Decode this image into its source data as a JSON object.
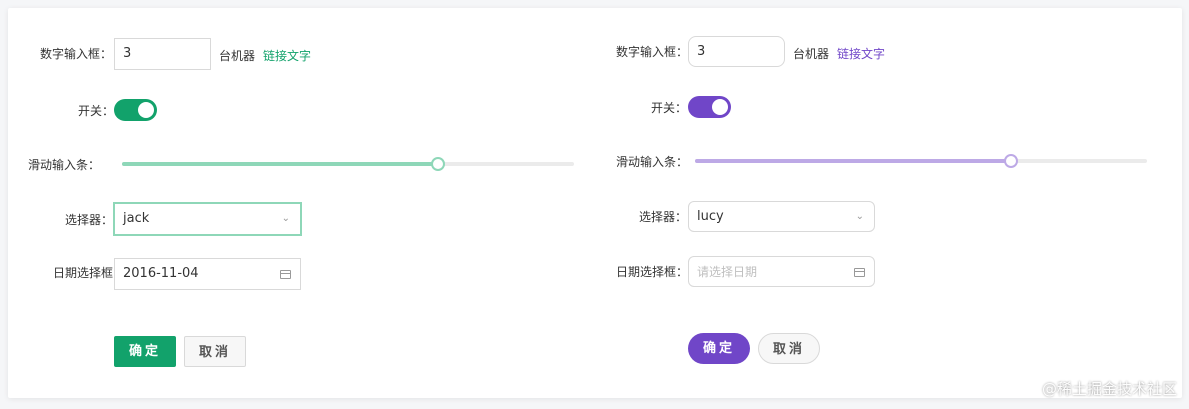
{
  "left": {
    "accent": "#12a26b",
    "accent_light": "#8ed7b8",
    "number_label": "数字输入框：",
    "number_value": "3",
    "machine_text": "台机器",
    "link_text": "链接文字",
    "switch_label": "开关：",
    "switch_on": true,
    "slider_label": "滑动输入条：",
    "slider_value": 0.7,
    "select_label": "选择器：",
    "select_value": "jack",
    "date_label": "日期选择框：",
    "date_value": "2016-11-04",
    "ok_label": "确定",
    "cancel_label": "取消"
  },
  "right": {
    "accent": "#7046c8",
    "accent_light": "#bda9e6",
    "number_label": "数字输入框：",
    "number_value": "3",
    "machine_text": "台机器",
    "link_text": "链接文字",
    "switch_label": "开关：",
    "switch_on": true,
    "slider_label": "滑动输入条：",
    "slider_value": 0.7,
    "select_label": "选择器：",
    "select_value": "lucy",
    "date_label": "日期选择框：",
    "date_placeholder": "请选择日期",
    "ok_label": "确定",
    "cancel_label": "取消"
  },
  "watermark": "@稀土掘金技术社区",
  "icons": {
    "chevron": "chevron-down-icon",
    "calendar": "calendar-icon"
  }
}
